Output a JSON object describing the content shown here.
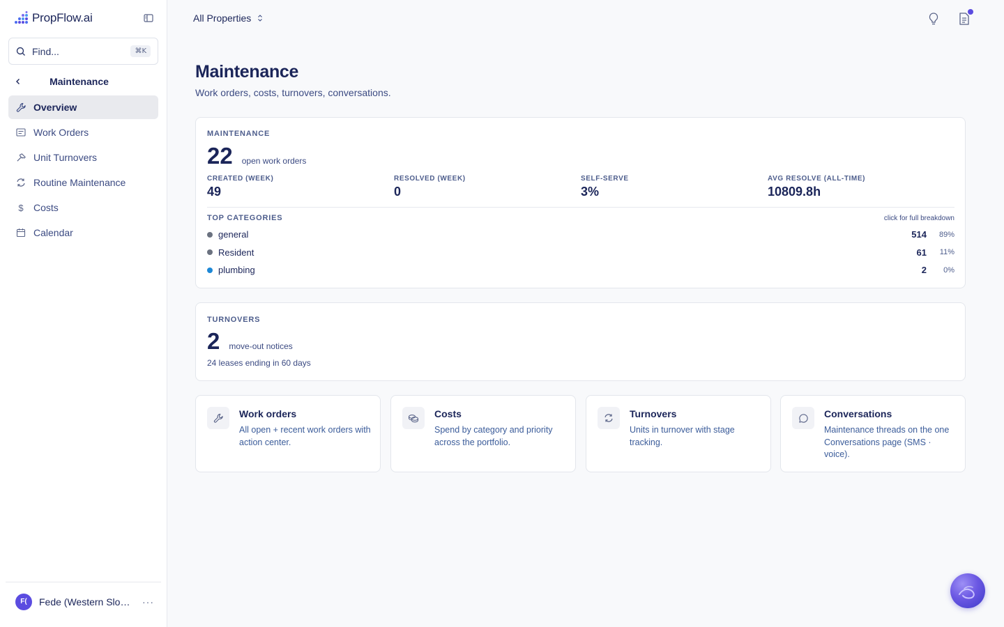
{
  "app": {
    "name": "PropFlow.ai"
  },
  "sidebar": {
    "search_placeholder": "Find...",
    "search_shortcut": "⌘K",
    "section_title": "Maintenance",
    "items": [
      {
        "label": "Overview",
        "icon": "wrench-icon",
        "active": true
      },
      {
        "label": "Work Orders",
        "icon": "list-icon",
        "active": false
      },
      {
        "label": "Unit Turnovers",
        "icon": "hammer-icon",
        "active": false
      },
      {
        "label": "Routine Maintenance",
        "icon": "refresh-icon",
        "active": false
      },
      {
        "label": "Costs",
        "icon": "dollar-icon",
        "active": false
      },
      {
        "label": "Calendar",
        "icon": "calendar-icon",
        "active": false
      }
    ],
    "user": {
      "initials": "F(",
      "name": "Fede (Western Slope)"
    }
  },
  "topbar": {
    "property_selector": "All Properties"
  },
  "page": {
    "title": "Maintenance",
    "subtitle": "Work orders, costs, turnovers, conversations."
  },
  "maintenance_card": {
    "kicker": "MAINTENANCE",
    "open_count": "22",
    "open_label": "open work orders",
    "stats": [
      {
        "label": "CREATED (WEEK)",
        "value": "49"
      },
      {
        "label": "RESOLVED (WEEK)",
        "value": "0"
      },
      {
        "label": "SELF-SERVE",
        "value": "3%"
      },
      {
        "label": "AVG RESOLVE (ALL-TIME)",
        "value": "10809.8h"
      }
    ],
    "categories_title": "TOP CATEGORIES",
    "categories_link": "click for full breakdown",
    "categories": [
      {
        "name": "general",
        "count": "514",
        "pct": "89%",
        "color": "#6b7280"
      },
      {
        "name": "Resident",
        "count": "61",
        "pct": "11%",
        "color": "#6b7280"
      },
      {
        "name": "plumbing",
        "count": "2",
        "pct": "0%",
        "color": "#1e88d6"
      }
    ]
  },
  "turnovers_card": {
    "kicker": "TURNOVERS",
    "count": "2",
    "count_label": "move-out notices",
    "sub": "24 leases ending in 60 days"
  },
  "tiles": [
    {
      "title": "Work orders",
      "desc": "All open + recent work orders with action center.",
      "icon": "wrench-icon"
    },
    {
      "title": "Costs",
      "desc": "Spend by category and priority across the portfolio.",
      "icon": "coins-icon"
    },
    {
      "title": "Turnovers",
      "desc": "Units in turnover with stage tracking.",
      "icon": "refresh-icon"
    },
    {
      "title": "Conversations",
      "desc": "Maintenance threads on the one Conversations page (SMS · voice).",
      "icon": "chat-icon"
    }
  ],
  "colors": {
    "accent": "#5b4ce0",
    "text": "#1b2559",
    "muted": "#3b4a82"
  }
}
